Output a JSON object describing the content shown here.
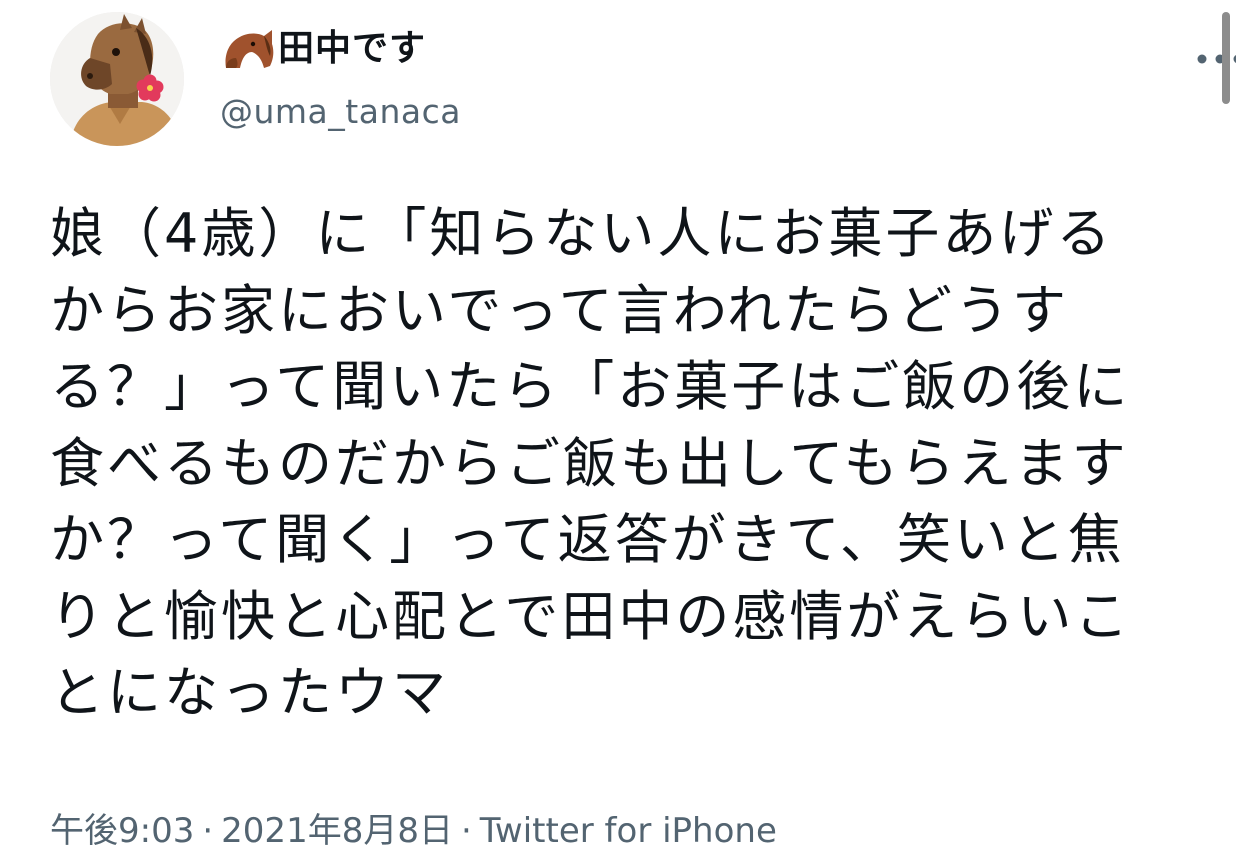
{
  "author": {
    "display_name": "田中です",
    "handle": "@uma_tanaca",
    "avatar_icon": "horse-mask-avatar",
    "name_emoji_icon": "horse-face-icon"
  },
  "menu": {
    "more_icon": "more-dots-icon"
  },
  "tweet": {
    "text": "娘（4歳）に「知らない人にお菓子あげるからお家においでって言われたらどうする？」って聞いたら「お菓子はご飯の後に食べるものだからご飯も出してもらえますか？って聞く」って返答がきて、笑いと焦りと愉快と心配とで田中の感情がえらいことになったウマ"
  },
  "meta": {
    "time": "午後9:03",
    "separator": "·",
    "date": "2021年8月8日",
    "source": "Twitter for iPhone"
  },
  "colors": {
    "text_primary": "#0f1419",
    "text_secondary": "#536471",
    "background": "#ffffff"
  }
}
